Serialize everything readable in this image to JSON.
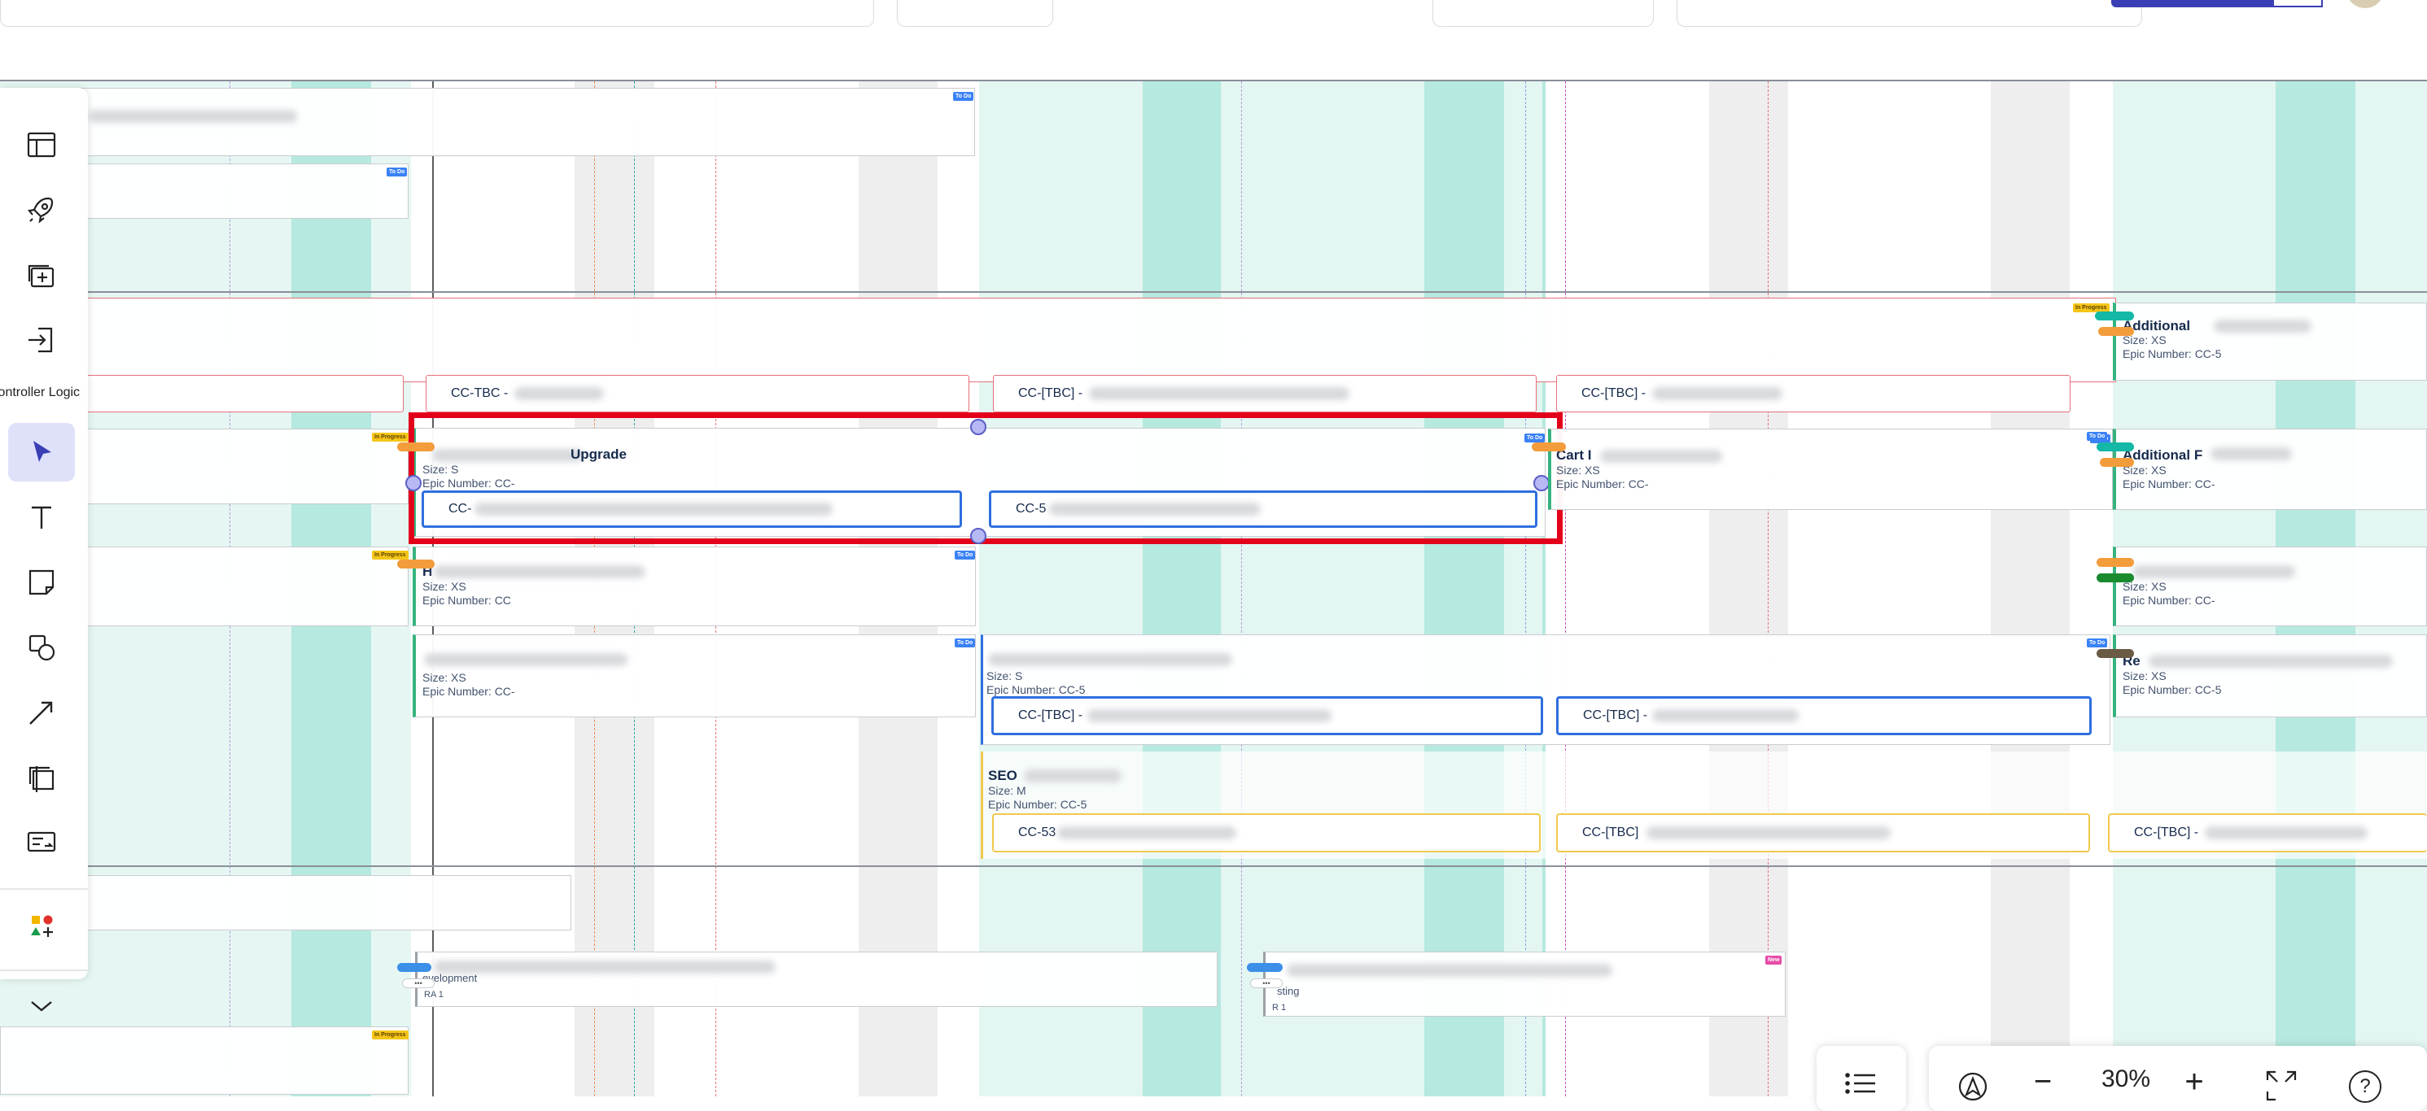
{
  "toolbar": {
    "items": [
      {
        "name": "table-icon",
        "label": ""
      },
      {
        "name": "rocket-icon",
        "label": ""
      },
      {
        "name": "add-frame-icon",
        "label": ""
      },
      {
        "name": "import-icon",
        "label": ""
      },
      {
        "name": "controller-logic-item",
        "label": "Controller Logic"
      },
      {
        "name": "select-pointer-icon",
        "label": ""
      },
      {
        "name": "text-icon",
        "label": ""
      },
      {
        "name": "sticky-note-icon",
        "label": ""
      },
      {
        "name": "shapes-icon",
        "label": ""
      },
      {
        "name": "arrow-icon",
        "label": ""
      },
      {
        "name": "frame-icon",
        "label": ""
      },
      {
        "name": "card-icon",
        "label": ""
      },
      {
        "name": "components-icon",
        "label": ""
      },
      {
        "name": "chevron-down-icon",
        "label": ""
      }
    ]
  },
  "zoom": {
    "value": "30%",
    "minus": "−",
    "plus": "+",
    "help": "?"
  },
  "colors": {
    "selection": "#e3001b",
    "accent": "#3b3fb5",
    "teal_band": "#b5e9df",
    "teal_light": "#e3f6f2"
  },
  "badges": {
    "todo": "To Do",
    "in_progress": "In Progress",
    "new": "New"
  },
  "cards": {
    "upgrade": {
      "title": "Upgrade",
      "size": "Size: S",
      "epic": "Epic Number: CC-",
      "sub1": "CC-",
      "sub2": "CC-5"
    },
    "cart": {
      "title": "Cart I",
      "size": "Size: XS",
      "epic": "Epic Number: CC-"
    },
    "h_card": {
      "title": "H",
      "size": "Size: XS",
      "epic": "Epic Number: CC"
    },
    "xs_card": {
      "size": "Size: XS",
      "epic": "Epic Number: CC-"
    },
    "s_card": {
      "size": "Size: S",
      "epic": "Epic Number: CC-5",
      "sub1": "CC-[TBC] -",
      "sub2": "CC-[TBC] -"
    },
    "seo": {
      "title": "SEO",
      "size": "Size: M",
      "epic": "Epic Number: CC-5",
      "sub1": "CC-53",
      "sub2": "CC-[TBC]",
      "sub3": "CC-[TBC] -"
    },
    "additional1": {
      "title": "Additional",
      "size": "Size: XS",
      "epic": "Epic Number: CC-5"
    },
    "additional2": {
      "title": "Additional F",
      "size": "Size: XS",
      "epic": "Epic Number: CC-"
    },
    "r3": {
      "title": "",
      "size": "Size: XS",
      "epic": "Epic Number: CC-"
    },
    "re": {
      "title": "Re",
      "size": "Size: XS",
      "epic": "Epic Number: CC-5"
    },
    "development": {
      "title": "evelopment",
      "ra": "RA  1"
    },
    "testing": {
      "title": "sting",
      "r": "R  1"
    }
  },
  "red_row": {
    "c1": "CC-TBC -",
    "c2": "CC-[TBC] -",
    "c3": "CC-[TBC] -"
  }
}
